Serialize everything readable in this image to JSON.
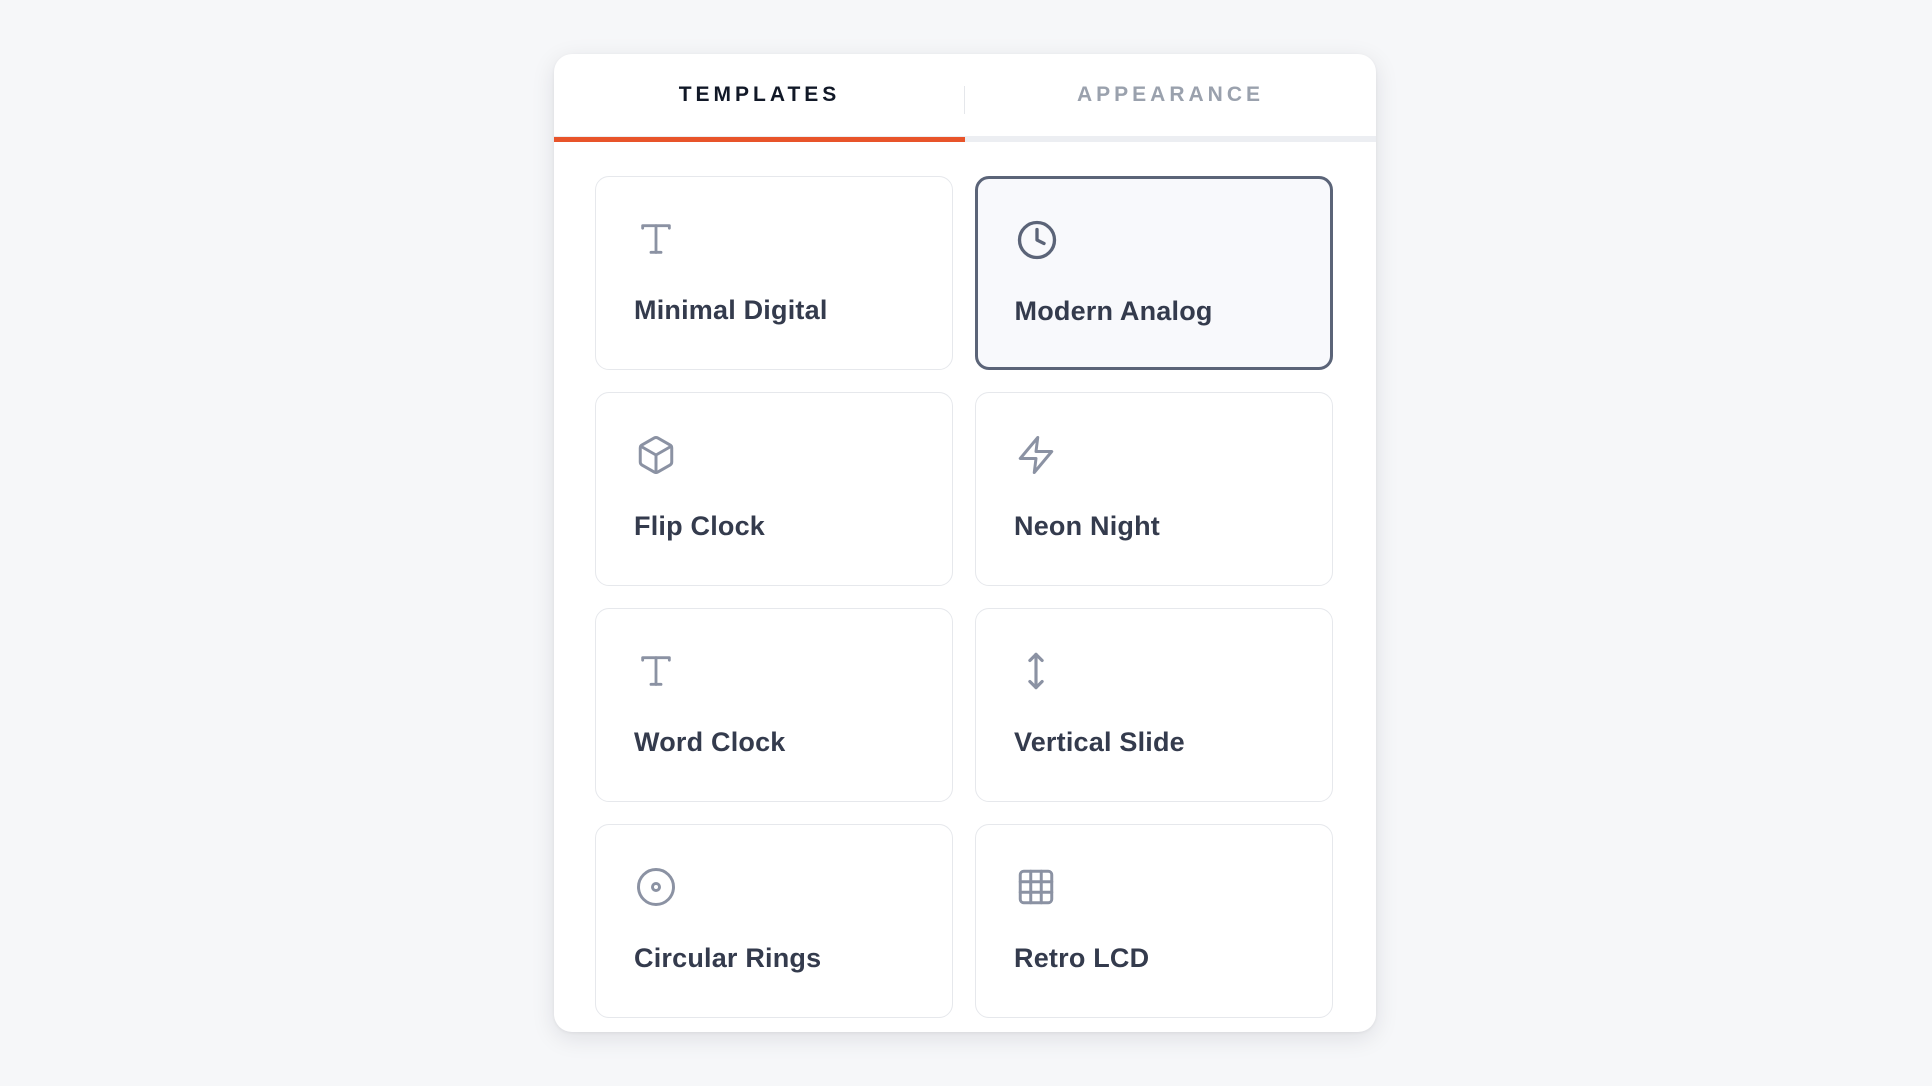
{
  "tabs": [
    {
      "label": "TEMPLATES",
      "active": true
    },
    {
      "label": "APPEARANCE",
      "active": false
    }
  ],
  "accent_color": "#e8542a",
  "templates": [
    {
      "label": "Minimal Digital",
      "icon": "text-icon",
      "selected": false
    },
    {
      "label": "Modern Analog",
      "icon": "clock-icon",
      "selected": true
    },
    {
      "label": "Flip Clock",
      "icon": "cube-icon",
      "selected": false
    },
    {
      "label": "Neon Night",
      "icon": "lightning-icon",
      "selected": false
    },
    {
      "label": "Word Clock",
      "icon": "text-icon",
      "selected": false
    },
    {
      "label": "Vertical Slide",
      "icon": "arrows-vertical-icon",
      "selected": false
    },
    {
      "label": "Circular Rings",
      "icon": "target-icon",
      "selected": false
    },
    {
      "label": "Retro LCD",
      "icon": "grid-icon",
      "selected": false
    }
  ]
}
